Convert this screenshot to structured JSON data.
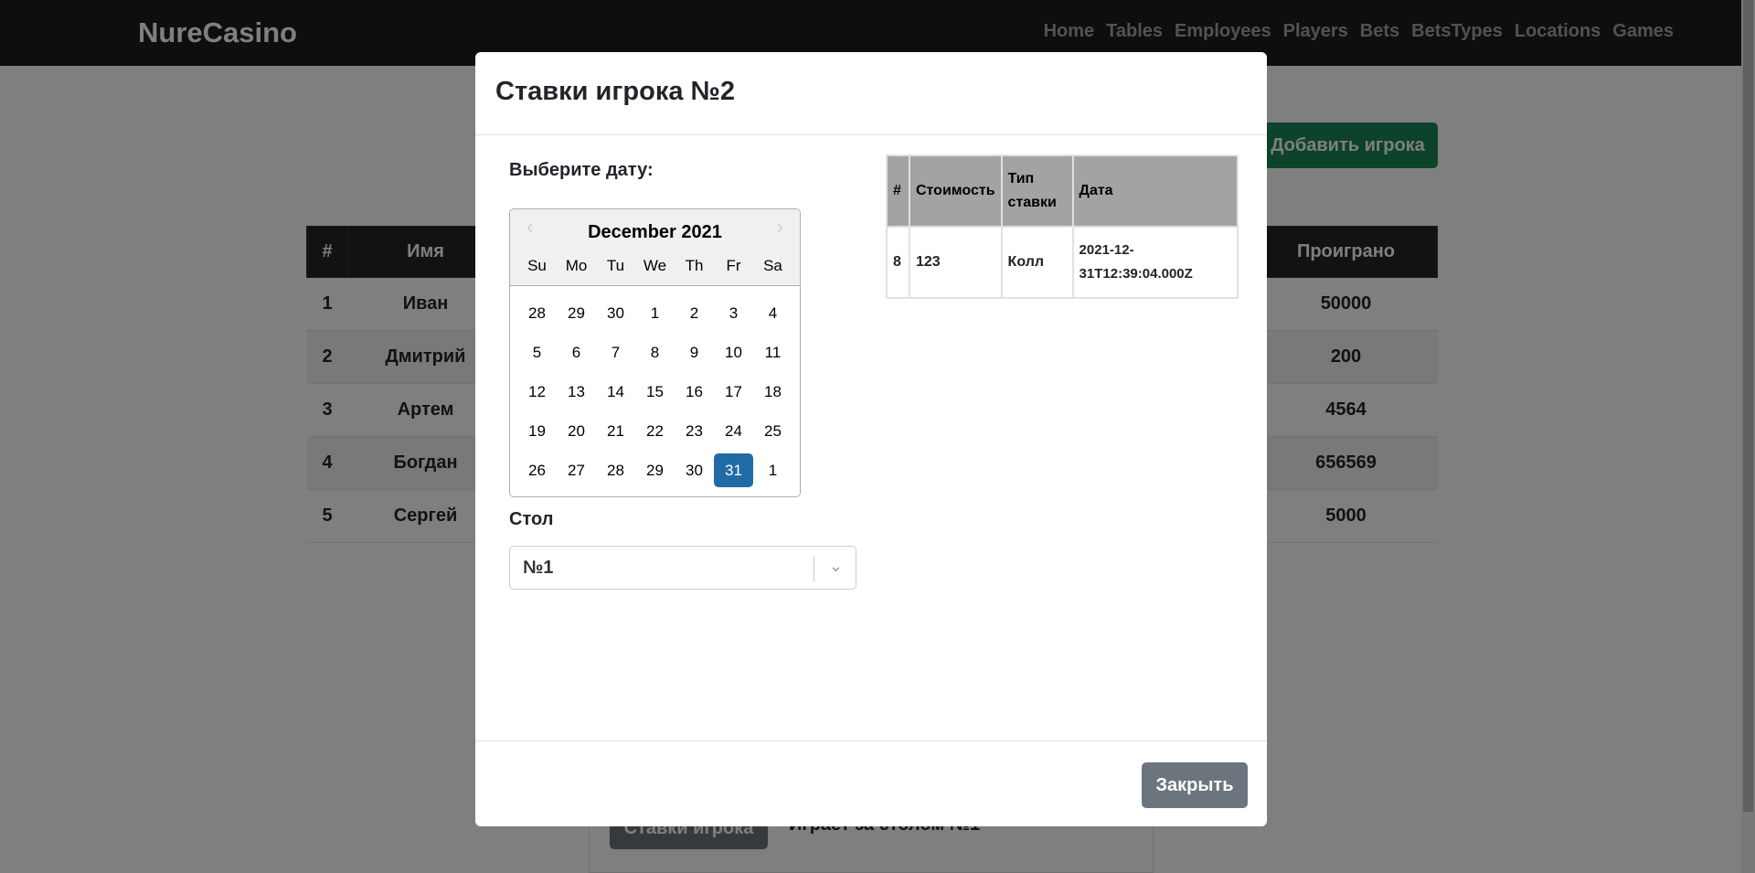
{
  "navbar": {
    "brand": "NureCasino",
    "links": [
      "Home",
      "Tables",
      "Employees",
      "Players",
      "Bets",
      "BetsTypes",
      "Locations",
      "Games"
    ]
  },
  "background": {
    "add_player_button": "Добавить игрока",
    "table_headers": {
      "num": "#",
      "name": "Имя",
      "lost": "Проиграно"
    },
    "rows": [
      {
        "num": "1",
        "name": "Иван",
        "lost": "50000"
      },
      {
        "num": "2",
        "name": "Дмитрий",
        "lost": "200"
      },
      {
        "num": "3",
        "name": "Артем",
        "lost": "4564"
      },
      {
        "num": "4",
        "name": "Богдан",
        "lost": "656569"
      },
      {
        "num": "5",
        "name": "Сергей",
        "lost": "5000"
      }
    ],
    "card_button": "Ставки игрока",
    "card_text": "Играет за столом №1"
  },
  "modal": {
    "title": "Ставки игрока №2",
    "date_label": "Выберите дату:",
    "calendar": {
      "month": "December 2021",
      "weekdays": [
        "Su",
        "Mo",
        "Tu",
        "We",
        "Th",
        "Fr",
        "Sa"
      ],
      "weeks": [
        [
          "28",
          "29",
          "30",
          "1",
          "2",
          "3",
          "4"
        ],
        [
          "5",
          "6",
          "7",
          "8",
          "9",
          "10",
          "11"
        ],
        [
          "12",
          "13",
          "14",
          "15",
          "16",
          "17",
          "18"
        ],
        [
          "19",
          "20",
          "21",
          "22",
          "23",
          "24",
          "25"
        ],
        [
          "26",
          "27",
          "28",
          "29",
          "30",
          "31",
          "1"
        ]
      ],
      "selected_day": "31"
    },
    "table_label": "Стол",
    "table_select_value": "№1",
    "bets_table": {
      "headers": {
        "num": "#",
        "cost": "Стоимость",
        "type": "Тип ставки",
        "date": "Дата"
      },
      "rows": [
        {
          "num": "8",
          "cost": "123",
          "type": "Колл",
          "date": "2021-12-31T12:39:04.000Z"
        }
      ]
    },
    "close_button": "Закрыть"
  }
}
